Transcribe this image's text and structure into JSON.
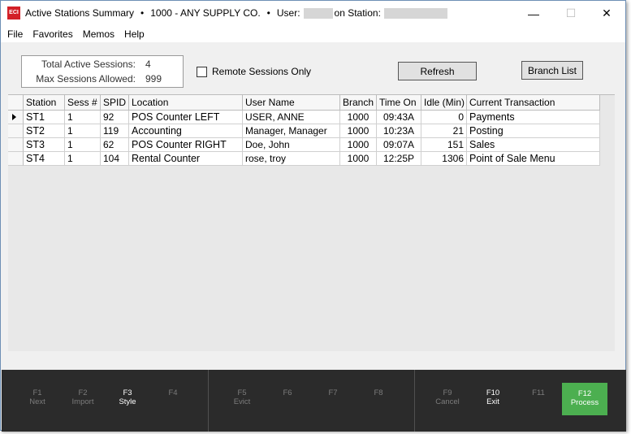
{
  "window": {
    "app_icon": "ECI",
    "title_prefix": "Active Stations Summary",
    "bullet": "•",
    "company": "1000 - ANY SUPPLY CO.",
    "user_label": "User:",
    "station_label": "on Station:",
    "minimize_glyph": "—",
    "maximize_glyph": "☐",
    "close_glyph": "✕"
  },
  "menu": [
    "File",
    "Favorites",
    "Memos",
    "Help"
  ],
  "sessions": {
    "total_label": "Total Active Sessions:",
    "total_value": "4",
    "max_label": "Max Sessions Allowed:",
    "max_value": "999"
  },
  "remote_only": {
    "label": "Remote Sessions Only",
    "checked": false
  },
  "buttons": {
    "refresh": "Refresh",
    "branch_list": "Branch List"
  },
  "grid": {
    "columns": [
      "Station",
      "Sess #",
      "SPID",
      "Location",
      "User Name",
      "Branch",
      "Time On",
      "Idle (Min)",
      "Current Transaction"
    ],
    "rows": [
      [
        "ST1",
        "1",
        "92",
        "POS Counter LEFT",
        "USER, ANNE",
        "1000",
        "09:43A",
        "0",
        "Payments"
      ],
      [
        "ST2",
        "1",
        "119",
        "Accounting",
        "Manager, Manager",
        "1000",
        "10:23A",
        "21",
        "Posting"
      ],
      [
        "ST3",
        "1",
        "62",
        "POS Counter RIGHT",
        "Doe, John",
        "1000",
        "09:07A",
        "151",
        "Sales"
      ],
      [
        "ST4",
        "1",
        "104",
        "Rental Counter",
        "rose, troy",
        "1000",
        "12:25P",
        "1306",
        "Point of Sale Menu"
      ]
    ]
  },
  "fkeys": [
    {
      "key": "F1",
      "label": "Next",
      "active": false
    },
    {
      "key": "F2",
      "label": "Import",
      "active": false
    },
    {
      "key": "F3",
      "label": "Style",
      "active": true
    },
    {
      "key": "F4",
      "label": "",
      "active": false
    },
    {
      "key": "F5",
      "label": "Evict",
      "active": false
    },
    {
      "key": "F6",
      "label": "",
      "active": false
    },
    {
      "key": "F7",
      "label": "",
      "active": false
    },
    {
      "key": "F8",
      "label": "",
      "active": false
    },
    {
      "key": "F9",
      "label": "Cancel",
      "active": false
    },
    {
      "key": "F10",
      "label": "Exit",
      "active": true
    },
    {
      "key": "F11",
      "label": "",
      "active": false
    },
    {
      "key": "F12",
      "label": "Process",
      "active": true
    }
  ],
  "colors": {
    "accent": "#4caf50",
    "icon_red": "#d32027",
    "fkey_bar": "#2b2b2b"
  }
}
